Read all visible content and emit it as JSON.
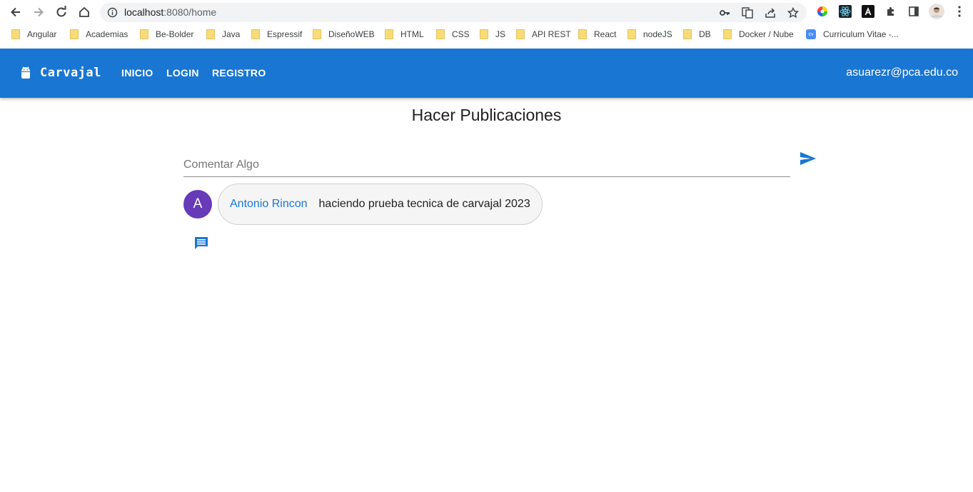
{
  "browser": {
    "url_host": "localhost",
    "url_path": ":8080/home",
    "bookmarks": [
      {
        "label": "Angular",
        "icon": "folder-icon"
      },
      {
        "label": "Academias",
        "icon": "folder-icon"
      },
      {
        "label": "Be-Bolder",
        "icon": "folder-icon"
      },
      {
        "label": "Java",
        "icon": "folder-icon"
      },
      {
        "label": "Espressif",
        "icon": "folder-icon"
      },
      {
        "label": "DiseñoWEB",
        "icon": "folder-icon"
      },
      {
        "label": "HTML",
        "icon": "folder-icon"
      },
      {
        "label": "CSS",
        "icon": "folder-icon"
      },
      {
        "label": "JS",
        "icon": "folder-icon"
      },
      {
        "label": "API REST",
        "icon": "folder-icon"
      },
      {
        "label": "React",
        "icon": "folder-icon"
      },
      {
        "label": "nodeJS",
        "icon": "folder-icon"
      },
      {
        "label": "DB",
        "icon": "folder-icon"
      },
      {
        "label": "Docker / Nube",
        "icon": "folder-icon"
      },
      {
        "label": "Curriculum Vitae -...",
        "icon": "cv-icon",
        "icon_text": "cv"
      }
    ]
  },
  "toolbar": {
    "brand_name": "Carvajal",
    "brand_icon": "android-icon",
    "nav": [
      {
        "label": "INICIO"
      },
      {
        "label": "LOGIN"
      },
      {
        "label": "REGISTRO"
      }
    ],
    "user_email": "asuarezr@pca.edu.co",
    "color": "#1976d2"
  },
  "main": {
    "title": "Hacer Publicaciones",
    "comment_placeholder": "Comentar Algo",
    "comment_value": "",
    "send_icon": "send-icon",
    "posts": [
      {
        "avatar_letter": "A",
        "avatar_color": "#673ab7",
        "author": "Antonio Rincon",
        "text": "haciendo prueba tecnica de carvajal 2023",
        "reply_icon": "comment-icon"
      }
    ]
  }
}
